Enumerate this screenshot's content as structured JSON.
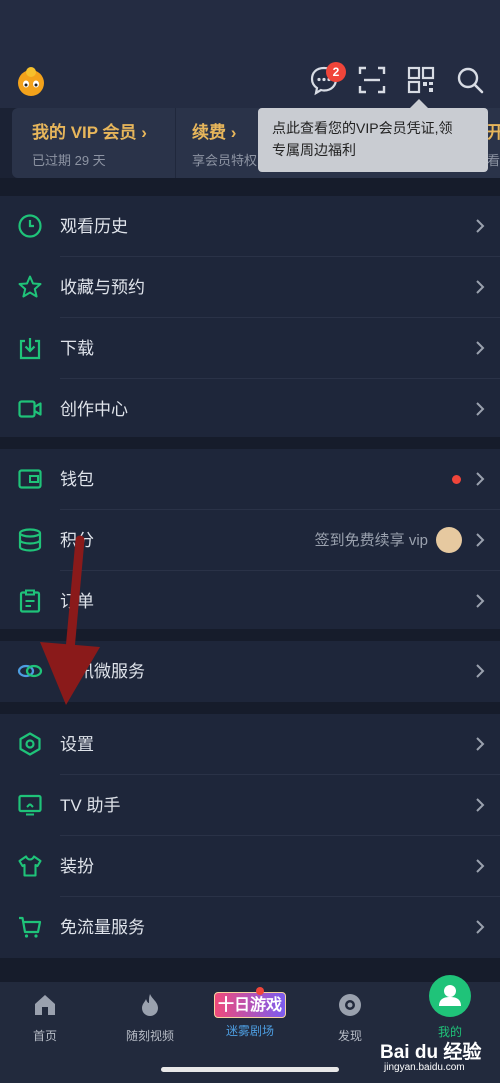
{
  "header": {
    "message_badge": "2"
  },
  "vip": {
    "card1_title": "我的 VIP 会员 ›",
    "card1_sub": "已过期 29 天",
    "card2_title": "续费 ›",
    "card2_sub": "享会员特权",
    "card3_title": "开",
    "card3_sub": "看"
  },
  "tooltip": {
    "line1": "点此查看您的VIP会员凭证,领",
    "line2": "专属周边福利"
  },
  "menu": {
    "history": "观看历史",
    "favorites": "收藏与预约",
    "download": "下载",
    "creator": "创作中心",
    "wallet": "钱包",
    "points": "积分",
    "points_hint": "签到免费续享 vip",
    "orders": "订单",
    "weiservice": "腾讯微服务",
    "settings": "设置",
    "tv": "TV 助手",
    "dressup": "装扮",
    "freeflow": "免流量服务"
  },
  "tabbar": {
    "home": "首页",
    "shorts": "随刻视频",
    "game_banner": "十日游戏",
    "drama": "迷雾剧场",
    "discover": "发现",
    "mine": "我的"
  },
  "watermark": {
    "brand": "Bai du 经验",
    "url": "jingyan.baidu.com"
  },
  "colors": {
    "accent_green": "#1fc379",
    "vip_gold": "#e7b65b",
    "badge_red": "#f0453a"
  }
}
